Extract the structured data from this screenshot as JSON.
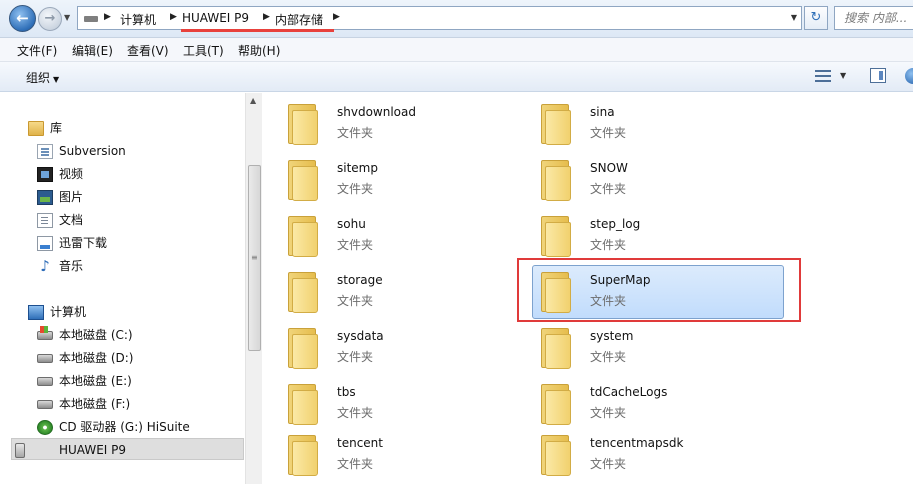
{
  "address_bar": {
    "back_icon": "back-arrow-icon",
    "forward_icon": "forward-arrow-icon",
    "breadcrumb": [
      "计算机",
      "HUAWEI P9",
      "内部存储"
    ],
    "refresh_icon": "refresh-icon",
    "search_placeholder": "搜索 内部..."
  },
  "menu": [
    "文件(F)",
    "编辑(E)",
    "查看(V)",
    "工具(T)",
    "帮助(H)"
  ],
  "command_bar": {
    "organize_label": "组织",
    "view_icon": "change-view-icon",
    "preview_pane_icon": "preview-pane-icon",
    "help_icon": "help-icon"
  },
  "nav_pane": {
    "items": [
      {
        "label": "库",
        "icon": "library-icon"
      },
      {
        "label": "Subversion",
        "icon": "subversion-icon"
      },
      {
        "label": "视频",
        "icon": "video-icon"
      },
      {
        "label": "图片",
        "icon": "pictures-icon"
      },
      {
        "label": "文档",
        "icon": "documents-icon"
      },
      {
        "label": "迅雷下载",
        "icon": "download-icon"
      },
      {
        "label": "音乐",
        "icon": "music-icon"
      },
      {
        "label": "计算机",
        "icon": "computer-icon"
      },
      {
        "label": "本地磁盘 (C:)",
        "icon": "system-drive-icon"
      },
      {
        "label": "本地磁盘 (D:)",
        "icon": "drive-icon"
      },
      {
        "label": "本地磁盘 (E:)",
        "icon": "drive-icon"
      },
      {
        "label": "本地磁盘 (F:)",
        "icon": "drive-icon"
      },
      {
        "label": "CD 驱动器 (G:) HiSuite",
        "icon": "cd-drive-icon"
      },
      {
        "label": "HUAWEI P9",
        "icon": "phone-icon",
        "selected": true
      }
    ]
  },
  "files": {
    "type_label": "文件夹",
    "items": [
      {
        "name": "shvdownload"
      },
      {
        "name": "sina"
      },
      {
        "name": "sitemp"
      },
      {
        "name": "SNOW"
      },
      {
        "name": "sohu"
      },
      {
        "name": "step_log"
      },
      {
        "name": "storage"
      },
      {
        "name": "SuperMap",
        "selected": true
      },
      {
        "name": "sysdata"
      },
      {
        "name": "system"
      },
      {
        "name": "tbs"
      },
      {
        "name": "tdCacheLogs"
      },
      {
        "name": "tencent"
      },
      {
        "name": "tencentmapsdk"
      }
    ]
  },
  "colors": {
    "selection": "#cce4fc",
    "annotation_red": "#e03a3a"
  }
}
